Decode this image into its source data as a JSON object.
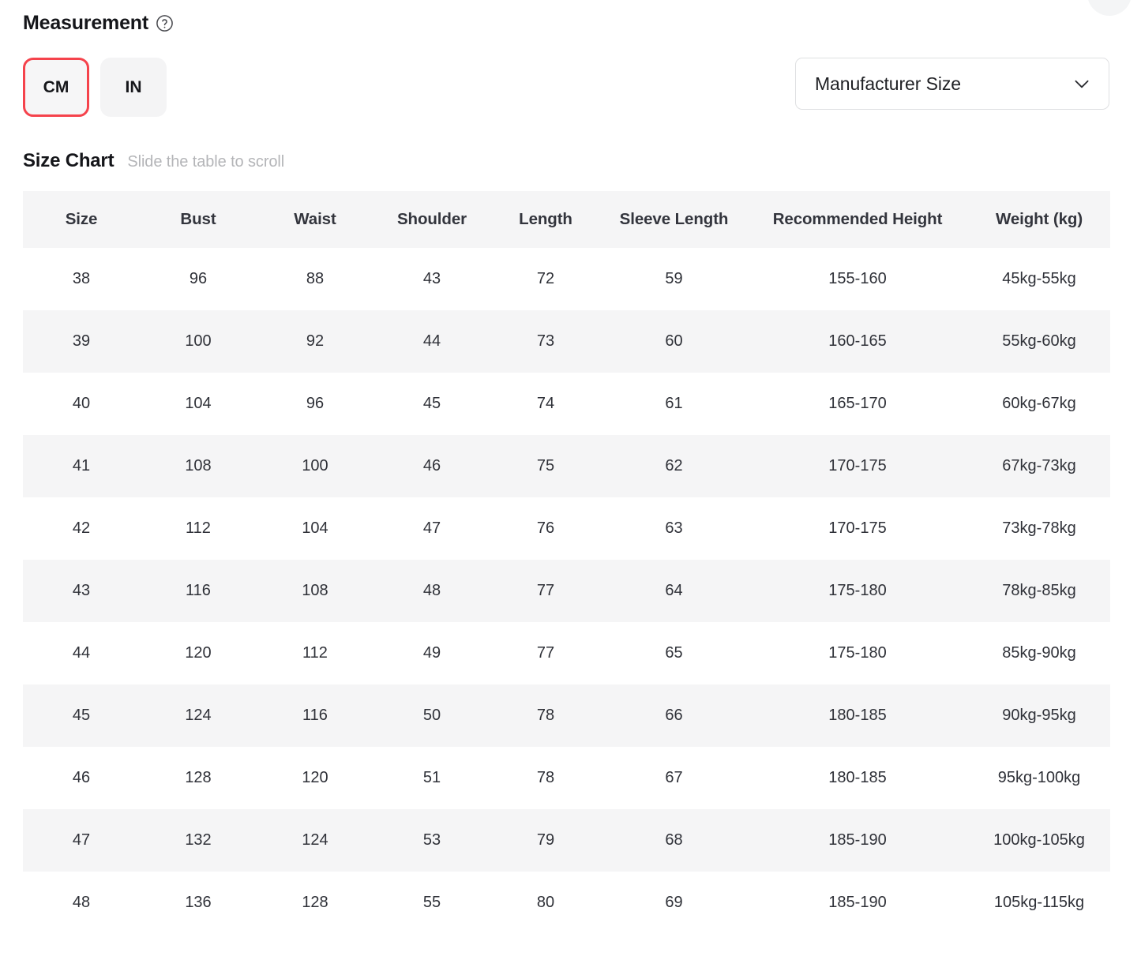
{
  "measurement": {
    "title": "Measurement",
    "help_icon": "question-mark-circle-icon",
    "units": [
      {
        "label": "CM",
        "selected": true
      },
      {
        "label": "IN",
        "selected": false
      }
    ],
    "selected_unit": "CM",
    "size_type_select": {
      "value": "Manufacturer Size",
      "icon": "chevron-down-icon"
    },
    "selected_border_color": "#f5434c"
  },
  "size_chart": {
    "title": "Size Chart",
    "hint": "Slide the table to scroll",
    "headers": [
      "Size",
      "Bust",
      "Waist",
      "Shoulder",
      "Length",
      "Sleeve Length",
      "Recommended Height",
      "Weight (kg)"
    ],
    "rows": [
      [
        "38",
        "96",
        "88",
        "43",
        "72",
        "59",
        "155-160",
        "45kg-55kg"
      ],
      [
        "39",
        "100",
        "92",
        "44",
        "73",
        "60",
        "160-165",
        "55kg-60kg"
      ],
      [
        "40",
        "104",
        "96",
        "45",
        "74",
        "61",
        "165-170",
        "60kg-67kg"
      ],
      [
        "41",
        "108",
        "100",
        "46",
        "75",
        "62",
        "170-175",
        "67kg-73kg"
      ],
      [
        "42",
        "112",
        "104",
        "47",
        "76",
        "63",
        "170-175",
        "73kg-78kg"
      ],
      [
        "43",
        "116",
        "108",
        "48",
        "77",
        "64",
        "175-180",
        "78kg-85kg"
      ],
      [
        "44",
        "120",
        "112",
        "49",
        "77",
        "65",
        "175-180",
        "85kg-90kg"
      ],
      [
        "45",
        "124",
        "116",
        "50",
        "78",
        "66",
        "180-185",
        "90kg-95kg"
      ],
      [
        "46",
        "128",
        "120",
        "51",
        "78",
        "67",
        "180-185",
        "95kg-100kg"
      ],
      [
        "47",
        "132",
        "124",
        "53",
        "79",
        "68",
        "185-190",
        "100kg-105kg"
      ],
      [
        "48",
        "136",
        "128",
        "55",
        "80",
        "69",
        "185-190",
        "105kg-115kg"
      ]
    ],
    "header_bg": "#f5f5f6",
    "alt_row_bg": "#f5f5f6"
  }
}
